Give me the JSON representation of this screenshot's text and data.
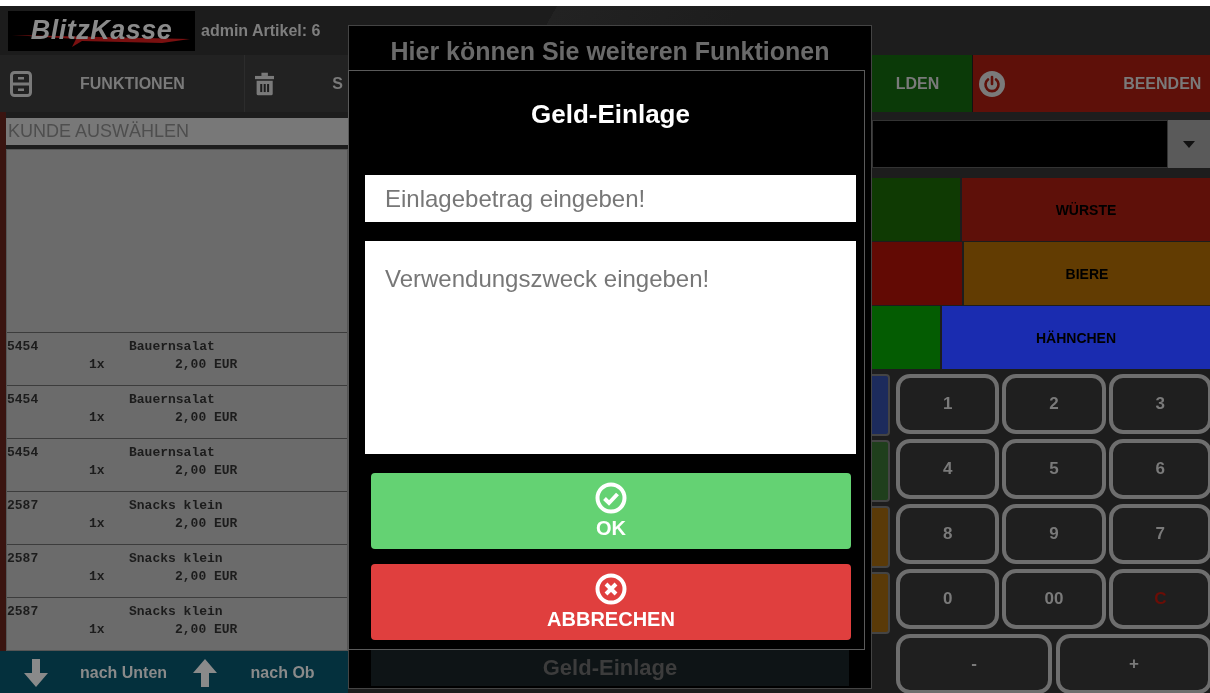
{
  "header": {
    "logo": "BlitzKasse",
    "user_info": "admin Artikel: 6"
  },
  "toolbar": {
    "left": [
      {
        "label": "FUNKTIONEN"
      },
      {
        "label": "S"
      }
    ],
    "right": [
      {
        "label": "LDEN",
        "color": "#0b3a08"
      },
      {
        "label": "BEENDEN",
        "color": "#5e1009"
      }
    ]
  },
  "customer_field": {
    "placeholder": "KUNDE AUSWÄHLEN"
  },
  "order_rows": [
    {
      "code": "5454",
      "name": "Bauernsalat",
      "qty": "1x",
      "price": "2,00 EUR"
    },
    {
      "code": "5454",
      "name": "Bauernsalat",
      "qty": "1x",
      "price": "2,00 EUR"
    },
    {
      "code": "5454",
      "name": "Bauernsalat",
      "qty": "1x",
      "price": "2,00 EUR"
    },
    {
      "code": "2587",
      "name": "Snacks klein",
      "qty": "1x",
      "price": "2,00 EUR"
    },
    {
      "code": "2587",
      "name": "Snacks klein",
      "qty": "1x",
      "price": "2,00 EUR"
    },
    {
      "code": "2587",
      "name": "Snacks klein",
      "qty": "1x",
      "price": "2,00 EUR"
    }
  ],
  "nav": [
    {
      "label": "nach Unten"
    },
    {
      "label": "nach Ob"
    }
  ],
  "categories": [
    {
      "tiles": [
        {
          "color": "#0f3a03"
        },
        {
          "label": "WÜRSTE",
          "color": "#5e1009"
        }
      ]
    },
    {
      "tiles": [
        {
          "color": "#620a04"
        },
        {
          "label": "BIERE",
          "color": "#623c02"
        }
      ]
    },
    {
      "tiles": [
        {
          "color": "#045c02"
        },
        {
          "label": "HÄHNCHEN",
          "color": "#1a2cb0"
        }
      ]
    }
  ],
  "keypad": {
    "side_keys": [
      {
        "color": "#1c2b5c"
      },
      {
        "color": "#1f3f1c"
      },
      {
        "color": "#5a3a08"
      },
      {
        "color": "#5a3a08"
      }
    ],
    "keys": [
      {
        "label": "1",
        "kind": "digit"
      },
      {
        "label": "2",
        "kind": "digit"
      },
      {
        "label": "3",
        "kind": "digit"
      },
      {
        "label": "4",
        "kind": "digit"
      },
      {
        "label": "5",
        "kind": "digit"
      },
      {
        "label": "6",
        "kind": "digit"
      },
      {
        "label": "8",
        "kind": "digit"
      },
      {
        "label": "9",
        "kind": "digit"
      },
      {
        "label": "7",
        "kind": "digit"
      },
      {
        "label": "0",
        "kind": "digit"
      },
      {
        "label": "00",
        "kind": "digit"
      },
      {
        "label": "C",
        "kind": "clear"
      }
    ],
    "wide_keys": [
      {
        "label": "-"
      },
      {
        "label": "+"
      }
    ]
  },
  "back_dialog": {
    "title": "Hier können Sie weiteren Funktionen",
    "button": "Geld-Einlage"
  },
  "dialog": {
    "title": "Geld-Einlage",
    "amount_field": {
      "placeholder": "Einlagebetrag eingeben!"
    },
    "purpose_field": {
      "placeholder": "Verwendungszweck eingeben!"
    },
    "buttons": [
      {
        "label": "OK",
        "kind": "confirm"
      },
      {
        "label": "ABBRECHEN",
        "kind": "cancel"
      }
    ]
  }
}
